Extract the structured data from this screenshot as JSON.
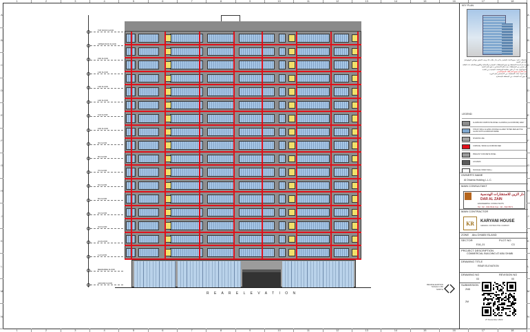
{
  "ruler": {
    "columns": [
      "1",
      "2",
      "3",
      "4",
      "5",
      "6",
      "7",
      "8",
      "9",
      "10",
      "11",
      "12",
      "13",
      "14",
      "15",
      "16",
      "17",
      "18"
    ],
    "rows": [
      "A",
      "B",
      "C",
      "D",
      "E",
      "F",
      "G",
      "H",
      "J",
      "K",
      "L",
      "M",
      "N"
    ]
  },
  "elevation": {
    "title": "R E A R   E L E V A T I O N",
    "levels": [
      "TOP ROOF FLOOR",
      "UPPER ROOF FLOOR",
      "15th FLOOR",
      "14th FLOOR",
      "13th FLOOR",
      "12th FLOOR",
      "11th FLOOR",
      "10th FLOOR",
      "9th FLOOR",
      "8th FLOOR",
      "7th FLOOR",
      "6th FLOOR",
      "5th FLOOR",
      "4th FLOOR",
      "3rd FLOOR",
      "2nd FLOOR",
      "1st FLOOR",
      "MEZZANINE FLOOR",
      "GROUND FLOOR"
    ],
    "scale_note": [
      "REAR ELEVATION",
      "SCALE 1:150",
      "NORTH"
    ]
  },
  "title_block": {
    "key_plan_label": "KEY PLAN",
    "notes": [
      "ملاحظات عامة: جميع الأبعاد بالمليمتر ما لم يذكر خلاف ذلك ويجب التحقق منها في الموقع قبل البدء في التنفيذ",
      "يجب قراءة هذا المخطط مع جميع المخططات المعمارية والإنشائية والكهروميكانيكية ذات العلاقة",
      "أي تعارض بين المخططات يجب إبلاغ الاستشاري به فورا قبل التنفيذ",
      "جميع المواد يجب أن تكون مطابقة للمواصفات المعتمدة من البلدية",
      "يتم اعتماد عينات التشطيبات من الاستشاري قبل التوريد",
      "لا يجوز أخذ القياسات من المخطط بالمسطرة"
    ],
    "notes_red": "يجب الالتزام بجميع اشتراطات الدفاع المدني",
    "legend_title": "LEGEND:",
    "legend": [
      {
        "color": "#8e8e8e",
        "text": "ALUMINIUM COMPOSITE PANEL CLADDING (ALUCOBOND) GREY"
      },
      {
        "color": "#7fa7cf",
        "text": "STRUCTURAL GLAZING DOUBLE GLAZED TINTED REFLECTIVE GLASS WITH ALUMINIUM FRAME"
      },
      {
        "color": "#a6a6a6",
        "text": "SHADOW LINE"
      },
      {
        "color": "#e0101a",
        "text": "CORNICE / BAND ALUCOBOND RED"
      },
      {
        "color": "#9c9c9c",
        "text": "PRECAST CONCRETE PANEL"
      },
      {
        "color": "#5a5a5a",
        "text": "LOUVERS"
      },
      {
        "color": "#ffffff",
        "text": "SIGNAGE (VIDEO WALL)"
      }
    ],
    "owner_label": "OWNER'S NAME",
    "owner": "Al Dhaena Holding L.L.C.",
    "consultant_label": "MAIN CONSULTANT",
    "consultant_ar": "دار الزين للاستشارات الهندسية",
    "consultant_en": "DAR AL ZAIN",
    "consultant_sub": "ENGINEERING CONSULTANTS",
    "consultant_tel": "Tel : 02 - 632 8111   Fax : 02 - 632 8671",
    "contractor_label": "MAIN CONTRACTOR",
    "contractor_logo": "KR",
    "contractor_name": "KARYANI HOUSE",
    "contractor_sub": "GENERAL CONTRACTING COMPANY",
    "zone_label": "ZONE",
    "zone": "Abu DHABI ISLAND",
    "sector_label": "SECTOR",
    "sector": "E18_01",
    "plot_label": "PLOT NO",
    "plot": "C3",
    "project_label": "PROJECT DESCRIPTION",
    "project": "COMMERCIAL BUILDING AT ABU DHABI",
    "drawing_title_label": "DRAWING TITLE",
    "drawing_title": "REAR ELEVATION",
    "drawing_no_label": "DRAWING NO",
    "drawing_no": "03",
    "revision_label": "REVISION NO",
    "revision": "00",
    "submission_label": "SUBMISSION",
    "submission": "2ND",
    "submission_no": "2M",
    "date": "27 December 2022"
  },
  "colors": {
    "cladding": "#8e8e8e",
    "glazing": "#a6c6e6",
    "accent_red": "#e0101a",
    "yellow_panel": "#f2e06a"
  }
}
